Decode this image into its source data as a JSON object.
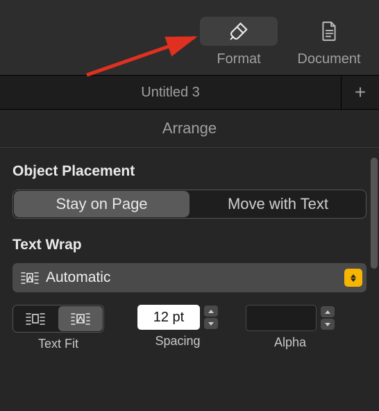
{
  "toolbar": {
    "format": {
      "label": "Format",
      "icon": "paintbrush-icon",
      "active": true
    },
    "document": {
      "label": "Document",
      "icon": "document-icon",
      "active": false
    }
  },
  "tabs": {
    "items": [
      {
        "title": "Untitled 3"
      }
    ],
    "add_tooltip": "+"
  },
  "inspector": {
    "header": "Arrange",
    "object_placement": {
      "label": "Object Placement",
      "options": [
        {
          "label": "Stay on Page",
          "selected": true
        },
        {
          "label": "Move with Text",
          "selected": false
        }
      ]
    },
    "text_wrap": {
      "label": "Text Wrap",
      "selected": "Automatic",
      "text_fit": {
        "label": "Text Fit",
        "options": [
          {
            "name": "fit-tight",
            "selected": false
          },
          {
            "name": "fit-loose",
            "selected": true
          }
        ]
      },
      "spacing": {
        "label": "Spacing",
        "value": "12 pt"
      },
      "alpha": {
        "label": "Alpha",
        "value": ""
      }
    }
  }
}
